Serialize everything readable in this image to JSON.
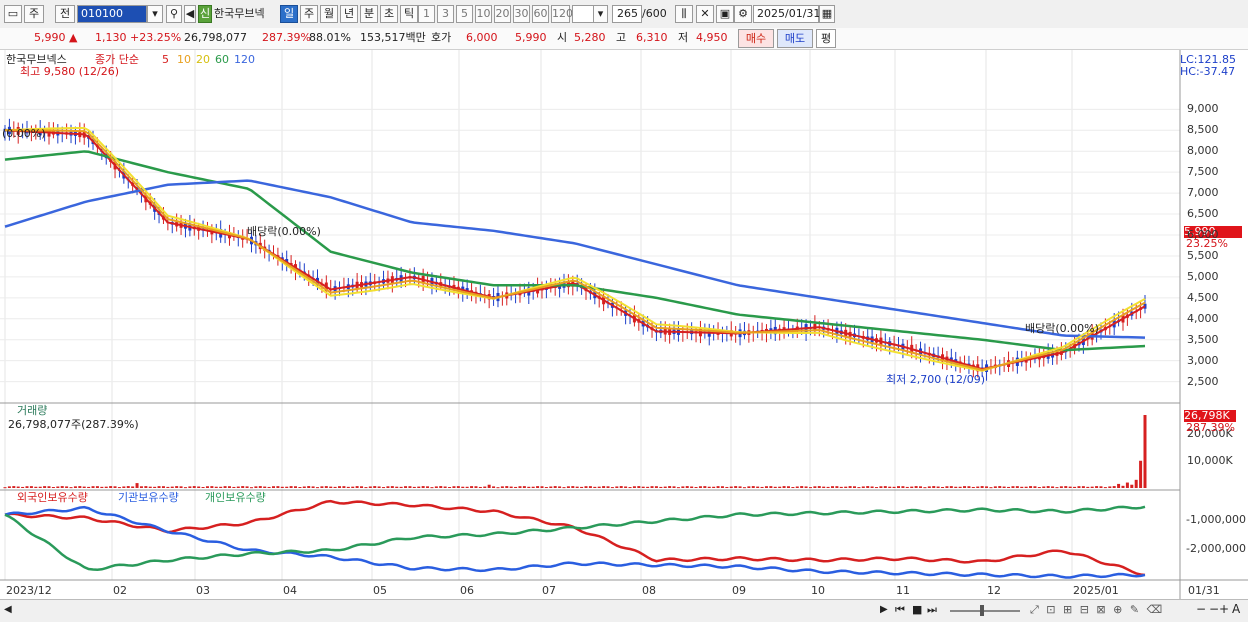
{
  "toolbar": {
    "tabs_left": [
      "주",
      "전"
    ],
    "code": "010100",
    "badge": "신",
    "stock_name": "한국무브넥",
    "periods": [
      "일",
      "주",
      "월",
      "년",
      "분",
      "초",
      "틱"
    ],
    "intervals": [
      "1",
      "3",
      "5",
      "10",
      "20",
      "30",
      "60",
      "120"
    ],
    "count": "265",
    "count_max": "/600",
    "date": "2025/01/31"
  },
  "quote": {
    "price": "5,990 ▲",
    "change": "1,130",
    "change_pct": "+23.25%",
    "volume": "26,798,077",
    "volume_ratio": "287.39%",
    "ratio2": "88.01%",
    "amount": "153,517백만",
    "ask_label": "호가",
    "ask": "6,000",
    "bid": "5,990",
    "open_label": "시",
    "open": "5,280",
    "high_label": "고",
    "high": "6,310",
    "low_label": "저",
    "low": "4,950",
    "buy_button": "매수",
    "sell_button": "매도",
    "avg_button": "평"
  },
  "price_panel": {
    "legend_name": "한국무브넥스",
    "legend_type": "종가 단순",
    "ma_labels": [
      "5",
      "10",
      "20",
      "60",
      "120"
    ],
    "ma_colors": [
      "#d62020",
      "#e8a020",
      "#f2e030",
      "#2a9a4a",
      "#3a66dd"
    ],
    "high_note": "최고 9,580 (12/26)",
    "low_note": "최저 2,700 (12/09)",
    "dividend_note_1": "배당락(0.00%)",
    "dividend_note_2": "배당락(0.00%)",
    "dividend_note_left": "(0.00%)",
    "lc": "LC:121.85",
    "hc": "HC:-37.47",
    "y_ticks": [
      "9,000",
      "8,500",
      "8,000",
      "7,500",
      "7,000",
      "6,500",
      "6,000",
      "5,500",
      "5,000",
      "4,500",
      "4,000",
      "3,500",
      "3,000",
      "2,500"
    ],
    "current_price_tag": "5,990",
    "current_pct_tag": "23.25%"
  },
  "volume_panel": {
    "title": "거래량",
    "value_text": "26,798,077주(287.39%)",
    "y_ticks": [
      "20,000K",
      "10,000K"
    ],
    "current_tag": "26,798K",
    "current_pct_tag": "287.39%"
  },
  "holder_panel": {
    "legend": [
      "외국인보유수량",
      "기관보유수량",
      "개인보유수량"
    ],
    "legend_colors": [
      "#d62020",
      "#2a5ee0",
      "#2a9a5a"
    ],
    "y_ticks": [
      "-1,000,000",
      "-2,000,000"
    ]
  },
  "x_axis": {
    "labels": [
      "2023/12",
      "02",
      "03",
      "04",
      "05",
      "06",
      "07",
      "08",
      "09",
      "10",
      "11",
      "12",
      "2025/01"
    ],
    "right_label": "01/31"
  },
  "chart_data": {
    "type": "line",
    "x": [
      "2023-12-01",
      "2024-01-01",
      "2024-02-01",
      "2024-03-01",
      "2024-04-01",
      "2024-05-01",
      "2024-06-01",
      "2024-07-01",
      "2024-08-01",
      "2024-09-01",
      "2024-10-01",
      "2024-11-01",
      "2024-12-01",
      "2025-01-01",
      "2025-01-31"
    ],
    "series": [
      {
        "name": "5",
        "values": [
          8500,
          8400,
          6300,
          5900,
          4700,
          5000,
          4500,
          4850,
          3700,
          3650,
          3800,
          3350,
          2800,
          3200,
          4300
        ]
      },
      {
        "name": "60",
        "values": [
          7800,
          8000,
          7500,
          7100,
          5600,
          5100,
          4800,
          4800,
          4500,
          4100,
          3900,
          3700,
          3500,
          3250,
          3350
        ]
      },
      {
        "name": "120",
        "values": [
          6200,
          6800,
          7200,
          7300,
          6900,
          6300,
          6100,
          5800,
          5300,
          4800,
          4500,
          4200,
          3900,
          3600,
          3550
        ]
      },
      {
        "name": "외국인보유수량",
        "values": [
          -1000000,
          -1100000,
          -1500000,
          -1250000,
          -600000,
          -700000,
          -900000,
          -1400000,
          -2400000,
          -2350000,
          -2400000,
          -2350000,
          -2450000,
          -2100000,
          -2850000
        ]
      },
      {
        "name": "기관보유수량",
        "values": [
          -1000000,
          -800000,
          -1500000,
          -2100000,
          -2300000,
          -2650000,
          -2700000,
          -2500000,
          -2550000,
          -2600000,
          -2750000,
          -2800000,
          -2850000,
          -2900000,
          -2850000
        ]
      },
      {
        "name": "개인보유수량",
        "values": [
          -1000000,
          -2700000,
          -2400000,
          -2200000,
          -2100000,
          -1700000,
          -1600000,
          -1400000,
          -1200000,
          -1000000,
          -950000,
          -900000,
          -850000,
          -900000,
          -750000
        ]
      }
    ],
    "ylim": [
      2300,
      9700
    ],
    "volume_peak": 26798077
  }
}
